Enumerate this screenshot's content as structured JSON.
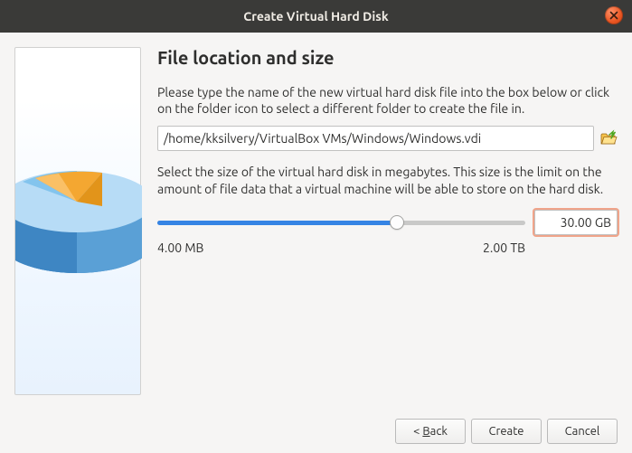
{
  "window": {
    "title": "Create Virtual Hard Disk"
  },
  "page": {
    "heading": "File location and size",
    "intro": "Please type the name of the new virtual hard disk file into the box below or click on the folder icon to select a different folder to create the file in.",
    "path_value": "/home/kksilvery/VirtualBox VMs/Windows/Windows.vdi",
    "size_desc": "Select the size of the virtual hard disk in megabytes. This size is the limit on the amount of file data that a virtual machine will be able to store on the hard disk.",
    "size_value": "30.00 GB",
    "range_min": "4.00 MB",
    "range_max": "2.00 TB"
  },
  "buttons": {
    "back_prefix": "< ",
    "back_u": "B",
    "back_suffix": "ack",
    "create": "Create",
    "cancel": "Cancel"
  }
}
